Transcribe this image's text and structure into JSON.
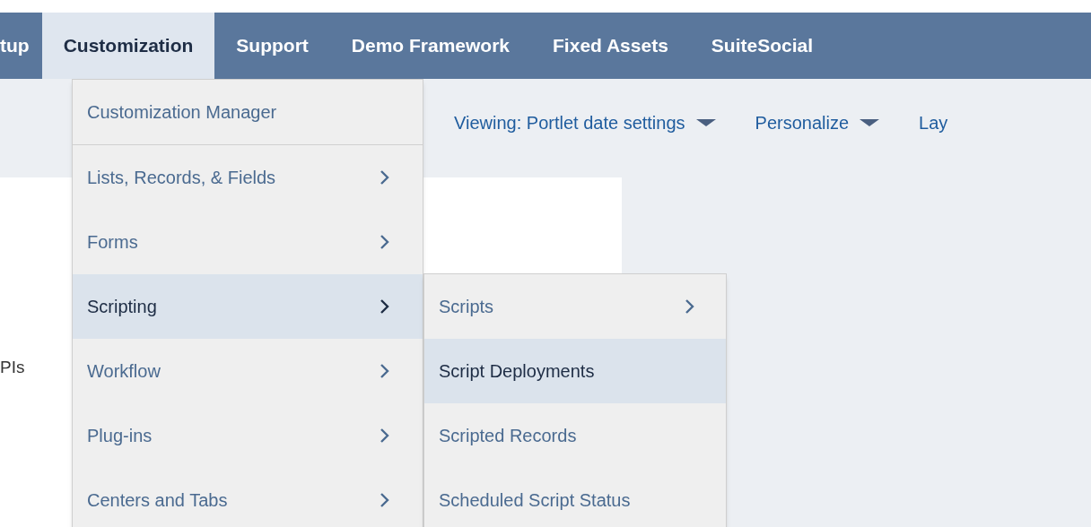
{
  "nav_tabs": [
    {
      "label": "tup",
      "selected": false
    },
    {
      "label": "Customization",
      "selected": true
    },
    {
      "label": "Support",
      "selected": false
    },
    {
      "label": "Demo Framework",
      "selected": false
    },
    {
      "label": "Fixed Assets",
      "selected": false
    },
    {
      "label": "SuiteSocial",
      "selected": false
    }
  ],
  "toolbar": [
    {
      "label": "Viewing: Portlet date settings",
      "dropdown": true
    },
    {
      "label": "Personalize",
      "dropdown": true
    },
    {
      "label": "Lay",
      "dropdown": false
    }
  ],
  "page_text": "PIs",
  "menu": {
    "items": [
      {
        "label": "Customization Manager",
        "submenu": false,
        "selected": false
      },
      {
        "label": "Lists, Records, & Fields",
        "submenu": true,
        "selected": false
      },
      {
        "label": "Forms",
        "submenu": true,
        "selected": false
      },
      {
        "label": "Scripting",
        "submenu": true,
        "selected": true
      },
      {
        "label": "Workflow",
        "submenu": true,
        "selected": false
      },
      {
        "label": "Plug-ins",
        "submenu": true,
        "selected": false
      },
      {
        "label": "Centers and Tabs",
        "submenu": true,
        "selected": false
      }
    ]
  },
  "submenu": {
    "items": [
      {
        "label": "Scripts",
        "submenu": true,
        "selected": false
      },
      {
        "label": "Script Deployments",
        "submenu": false,
        "selected": true
      },
      {
        "label": "Scripted Records",
        "submenu": false,
        "selected": false
      },
      {
        "label": "Scheduled Script Status",
        "submenu": false,
        "selected": false
      }
    ]
  }
}
